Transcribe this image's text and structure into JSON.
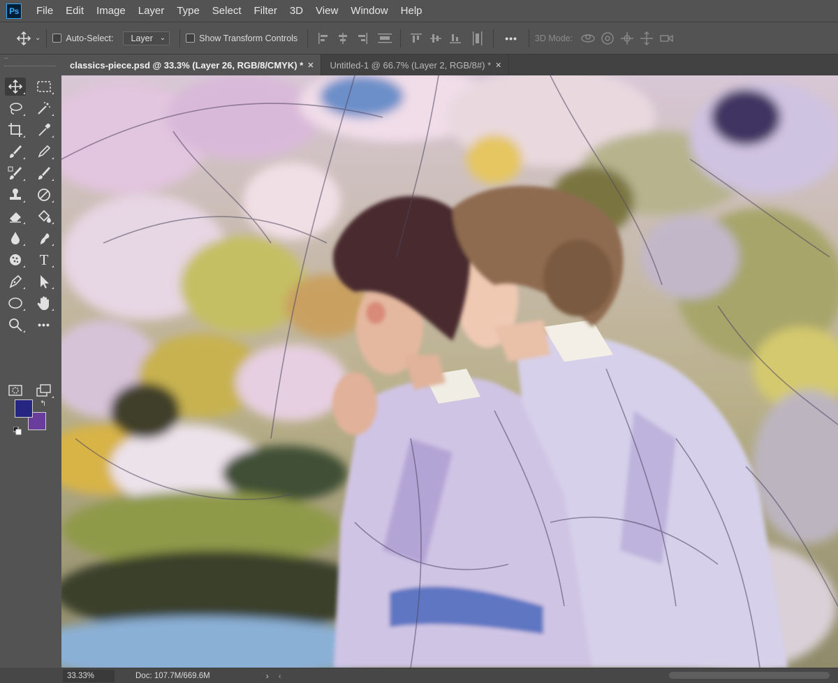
{
  "app": {
    "logo_text": "Ps",
    "menu": [
      "File",
      "Edit",
      "Image",
      "Layer",
      "Type",
      "Select",
      "Filter",
      "3D",
      "View",
      "Window",
      "Help"
    ]
  },
  "options_bar": {
    "auto_select_label": "Auto-Select:",
    "auto_select_value": "Layer",
    "show_transform_label": "Show Transform Controls",
    "more_label": "•••",
    "three_d_mode_label": "3D Mode:"
  },
  "tabs": [
    {
      "label": "classics-piece.psd @ 33.3% (Layer 26, RGB/8/CMYK) *",
      "active": true
    },
    {
      "label": "Untitled-1 @ 66.7% (Layer 2, RGB/8#) *",
      "active": false
    }
  ],
  "toolbox": {
    "grip": "››",
    "foreground_color": "#262582",
    "background_color": "#6a3c9c",
    "tools": [
      "move-tool",
      "marquee-tool",
      "lasso-tool",
      "magic-wand-tool",
      "crop-tool",
      "eyedropper-tool",
      "brush-tool",
      "pencil-tool",
      "mixer-brush-tool",
      "history-brush-tool",
      "clone-stamp-tool",
      "spot-healing-tool",
      "eraser-tool",
      "paint-bucket-tool",
      "blur-tool",
      "smudge-tool",
      "dodge-tool",
      "type-tool",
      "pen-tool",
      "path-selection-tool",
      "ellipse-tool",
      "hand-tool",
      "zoom-tool",
      "more-tools"
    ],
    "type_glyph": "T",
    "more_glyph": "•••"
  },
  "status_bar": {
    "zoom": "33.33%",
    "doc_info": "Doc: 107.7M/669.6M",
    "arrow": "›",
    "scroll_left": "‹"
  },
  "colors": {
    "ui_bg": "#535353",
    "tab_bg": "#424242",
    "accent_logo": "#31a8ff"
  }
}
